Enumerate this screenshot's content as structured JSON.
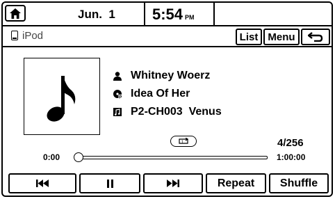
{
  "status": {
    "date": "Jun.  1",
    "time": "5:54",
    "ampm": "PM"
  },
  "source": {
    "label": "iPod",
    "list_label": "List",
    "menu_label": "Menu"
  },
  "track": {
    "artist": "Whitney Woerz",
    "album": "Idea Of Her",
    "title": "P2-CH003  Venus",
    "count": "4/256",
    "elapsed": "0:00",
    "duration": "1:00:00",
    "progress": 0
  },
  "controls": {
    "repeat_label": "Repeat",
    "shuffle_label": "Shuffle"
  },
  "icons": {
    "home": "home-icon",
    "ipod": "ipod-icon",
    "back": "back-icon",
    "music_note": "music-note-icon",
    "artist": "person-icon",
    "album": "disc-icon",
    "song": "song-icon",
    "repeat": "repeat-icon",
    "prev": "previous-track-icon",
    "pause": "pause-icon",
    "next": "next-track-icon"
  }
}
